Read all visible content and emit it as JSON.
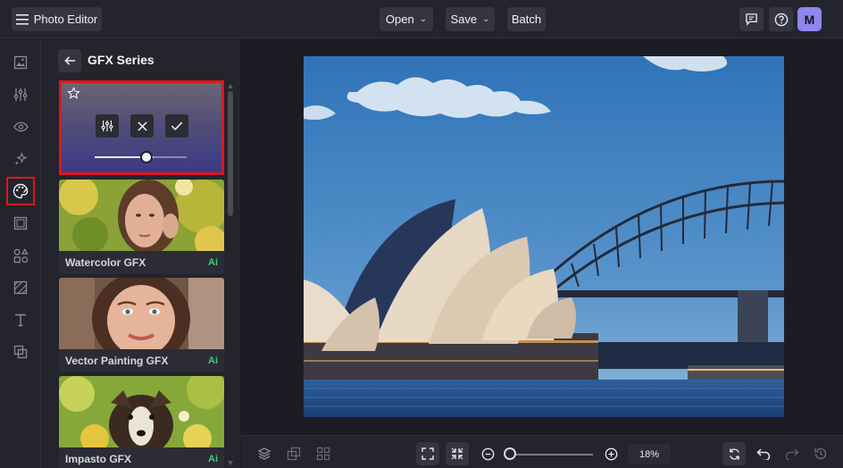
{
  "header": {
    "app_title": "Photo Editor",
    "open_label": "Open",
    "save_label": "Save",
    "batch_label": "Batch",
    "avatar_initial": "M"
  },
  "rail": {
    "items": [
      "image-icon",
      "adjust-icon",
      "eye-icon",
      "sparkle-icon",
      "palette-icon",
      "frame-icon",
      "shapes-icon",
      "texture-icon",
      "text-icon",
      "overlay-icon"
    ],
    "active": "palette-icon"
  },
  "panel": {
    "title": "GFX Series",
    "active_preset": {
      "intensity": 0.55
    },
    "cards": [
      {
        "label": "Watercolor GFX",
        "badge": "Ai"
      },
      {
        "label": "Vector Painting GFX",
        "badge": "Ai"
      },
      {
        "label": "Impasto GFX",
        "badge": "Ai"
      }
    ]
  },
  "footer": {
    "zoom": "18%"
  },
  "colors": {
    "highlight": "#e0161c",
    "accent": "#8f86f0",
    "ai_badge": "#3ccf78"
  }
}
